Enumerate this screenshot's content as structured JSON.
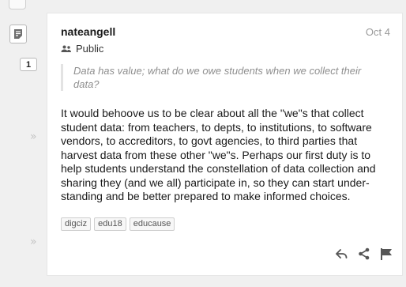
{
  "sidebar": {
    "reply_count": "1",
    "note_icon": "note-icon",
    "chevron_icon": "double-chevron-right-icon"
  },
  "annotation": {
    "author": "nateangell",
    "date": "Oct 4",
    "visibility": "Public",
    "quote": "Data has value; what do we owe students when we collect their data?",
    "body": "It would behoove us to be clear about all the \"we\"s that collect student data: from teachers, to depts, to institutions, to software vendors, to accreditors, to govt agencies, to third parties that harvest data from these other \"we\"s. Perhaps our first duty is to help students understand the constellation of data collection and sharing they (and we all) participate in, so they can start under-standing and be better prepared to make informed choices.",
    "tags": [
      "digciz",
      "edu18",
      "educause"
    ],
    "actions": [
      "reply-icon",
      "share-icon",
      "flag-icon"
    ]
  }
}
